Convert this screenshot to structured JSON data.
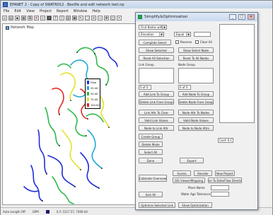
{
  "app": {
    "title": "EPANET 2 - Copy of SWAT6012 . Bexlife and adit network text.np",
    "menu": [
      "File",
      "Edit",
      "View",
      "Project",
      "Report",
      "Window",
      "Help"
    ]
  },
  "document": {
    "title": "Network Map"
  },
  "legend": {
    "colors": [
      "#1f2fd6",
      "#22a8d4",
      "#2fb84a",
      "#e4e22c",
      "#e42a22"
    ],
    "labels": [
      "Flow",
      "25.00",
      "50.00",
      "75.00",
      "100.00"
    ]
  },
  "statusbar": {
    "autolength": "Auto-Length Off",
    "units": "GPM",
    "xy": "X,Y: 3117.57, 7406.04"
  },
  "dialog": {
    "title": "Simplify&Optimization",
    "combo_find": "Find Nodes with",
    "combo_attr": "Elevation",
    "combo_op": "Equal",
    "val_find": "",
    "btn_complete_select": "Complete Select",
    "chk_reverse": "Reverse",
    "chk_clear_all": "Clear All",
    "btn_show_selected": "Show Selected",
    "btn_show_sel_nodes": "Show Select Node",
    "btn_reset_all_nodes": "Reset All Selection",
    "btn_reset_to_all": "Reset To All Nodes",
    "label_link_group": "Link Group",
    "label_node_group": "Node Group",
    "link_group_value": "0 of 0",
    "node_group_value": "0 of 0",
    "btn_add_link_group": "Add Link To Group",
    "btn_add_node_group": "Add Node To Group",
    "btn_delete_link_group": "Delete Link From Group",
    "btn_delete_node_group": "Delete Node From Group",
    "btn_link_attr": "Link Attr To Clear",
    "btn_node_attr": "Node Attr To Nodes",
    "btn_valid_link": "Valid Link Values",
    "btn_valid_node": "Valid Node Values",
    "btn_node_to_link": "Node to Link Attr",
    "btn_node_to_nodes": "Node to Node Attrs",
    "btn_create_group": "Create Group",
    "btn_delete_mode": "Delete Mode",
    "btn_select_all": "Select All",
    "btn_done": "Done",
    "btn_export": "Export",
    "btn_calibrate": "Calibrate Overview",
    "btn_scores": "Scores",
    "btn_reorder": "Reorder",
    "btn_new_project": "New Project",
    "btn_gis_viewer": "GIS Viewer/Mapping",
    "btn_save_to_file": "Save To Data/Flow Directory",
    "label_place_name": "Place Name",
    "label_water_age": "Water Age Tolerance",
    "btn_sort": "Sort All",
    "btn_optimize_links": "Optimize Selected Link",
    "btn_optimize_setting": "Show Optimization",
    "side_value": "Coef: 0.17"
  }
}
